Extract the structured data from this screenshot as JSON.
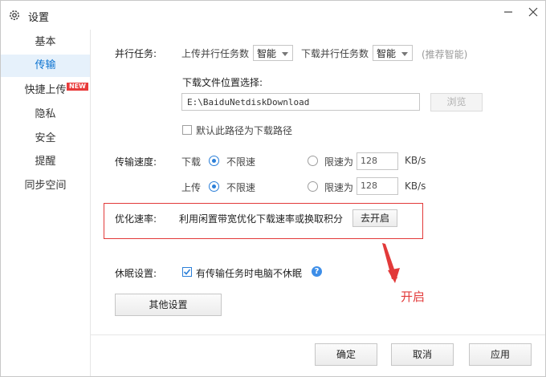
{
  "window": {
    "title": "设置"
  },
  "sidebar": {
    "items": [
      {
        "label": "基本"
      },
      {
        "label": "传输",
        "active": true
      },
      {
        "label": "快捷上传",
        "badge": "NEW"
      },
      {
        "label": "隐私"
      },
      {
        "label": "安全"
      },
      {
        "label": "提醒"
      },
      {
        "label": "同步空间"
      }
    ]
  },
  "parallel": {
    "label": "并行任务:",
    "upload_label": "上传并行任务数",
    "upload_value": "智能",
    "download_label": "下载并行任务数",
    "download_value": "智能",
    "hint": "(推荐智能)"
  },
  "download_location": {
    "label": "下载文件位置选择:",
    "path": "E:\\BaiduNetdiskDownload",
    "browse_label": "浏览",
    "default_checkbox_label": "默认此路径为下载路径",
    "default_checked": false
  },
  "speed": {
    "label": "传输速度:",
    "download_label": "下载",
    "upload_label": "上传",
    "unlimited_label": "不限速",
    "limit_label": "限速为",
    "download_limit": "128",
    "upload_limit": "128",
    "unit": "KB/s"
  },
  "optimize": {
    "label": "优化速率:",
    "desc": "利用闲置带宽优化下载速率或换取积分",
    "button_label": "去开启"
  },
  "sleep": {
    "label": "休眠设置:",
    "checkbox_label": "有传输任务时电脑不休眠",
    "checked": true
  },
  "other_settings_label": "其他设置",
  "footer": {
    "ok_label": "确定",
    "cancel_label": "取消",
    "apply_label": "应用"
  },
  "annotation": {
    "text": "开启"
  },
  "colors": {
    "accent": "#2b7fd8",
    "active_bg": "#e6f1fb",
    "highlight_red": "#e23a3a"
  }
}
